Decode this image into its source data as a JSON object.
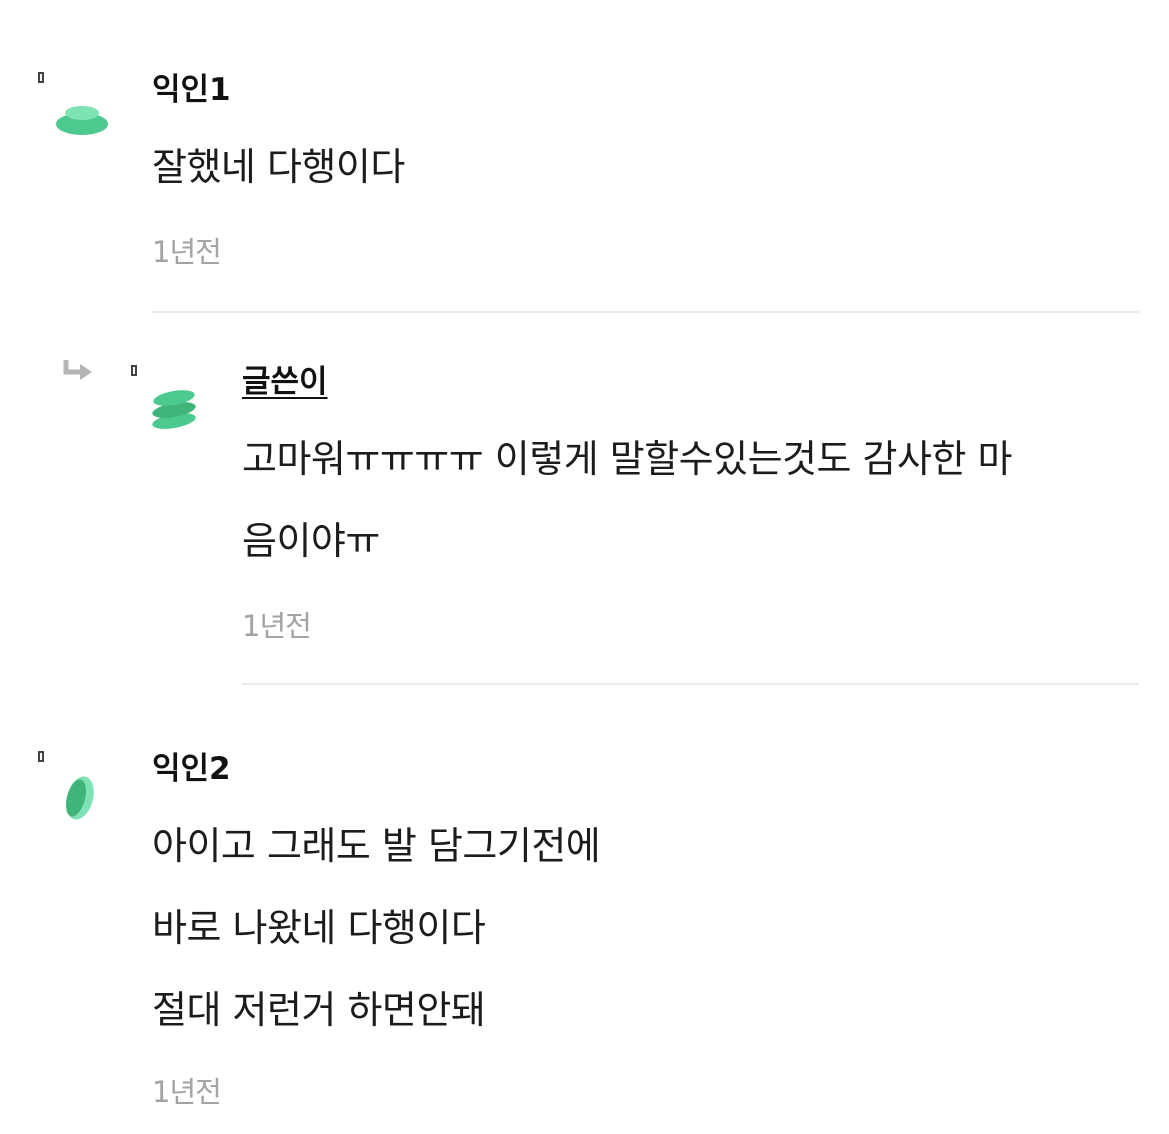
{
  "comments": [
    {
      "author": "익인1",
      "lines": [
        "잘했네 다행이다"
      ],
      "time": "1년전"
    },
    {
      "author": "글쓴이",
      "is_reply": true,
      "is_op": true,
      "lines": [
        "고마워ㅠㅠㅠㅠ 이렇게 말할수있는것도 감사한 마",
        "음이야ㅠ"
      ],
      "time": "1년전"
    },
    {
      "author": "익인2",
      "lines": [
        "아이고 그래도 발 담그기전에",
        "바로 나왔네 다행이다",
        "절대 저런거 하면안돼"
      ],
      "time": "1년전"
    }
  ],
  "colors": {
    "avatar_light": "#5fd6a0",
    "avatar_dark": "#3fb579",
    "time": "#a3a3a3",
    "divider": "#ebebeb"
  }
}
